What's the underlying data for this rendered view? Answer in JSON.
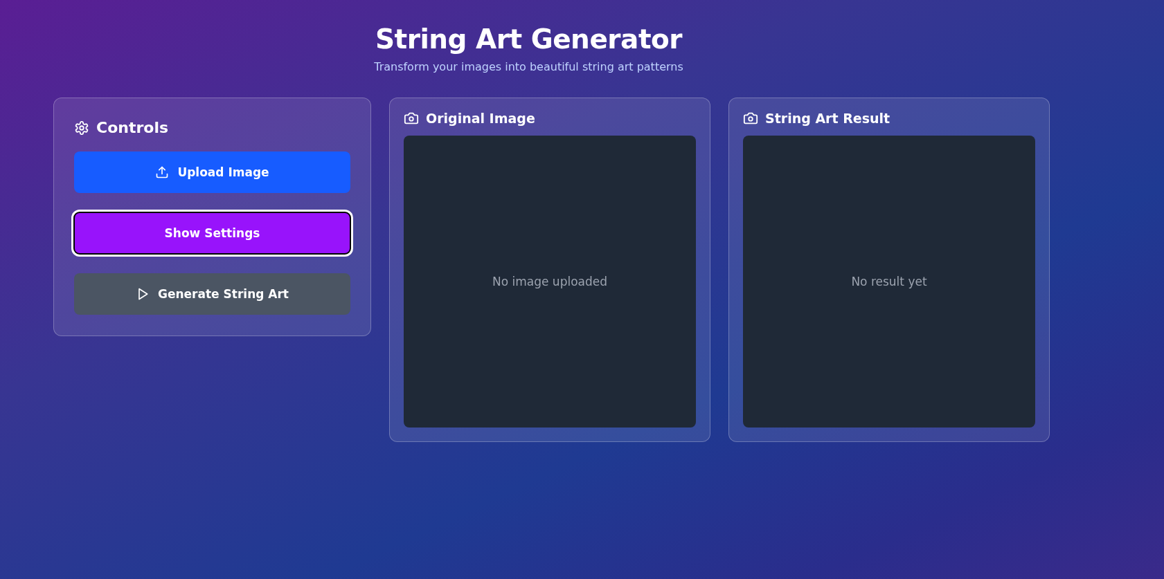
{
  "header": {
    "title": "String Art Generator",
    "subtitle": "Transform your images into beautiful string art patterns"
  },
  "controls": {
    "title": "Controls",
    "buttons": [
      {
        "label": "Upload Image",
        "kind": "upload",
        "focused": false
      },
      {
        "label": "Show Settings",
        "kind": "settings",
        "focused": true
      },
      {
        "label": "Generate String Art",
        "kind": "generate",
        "focused": false
      }
    ]
  },
  "panels": [
    {
      "title": "Original Image",
      "placeholder": "No image uploaded"
    },
    {
      "title": "String Art Result",
      "placeholder": "No result yet"
    }
  ]
}
